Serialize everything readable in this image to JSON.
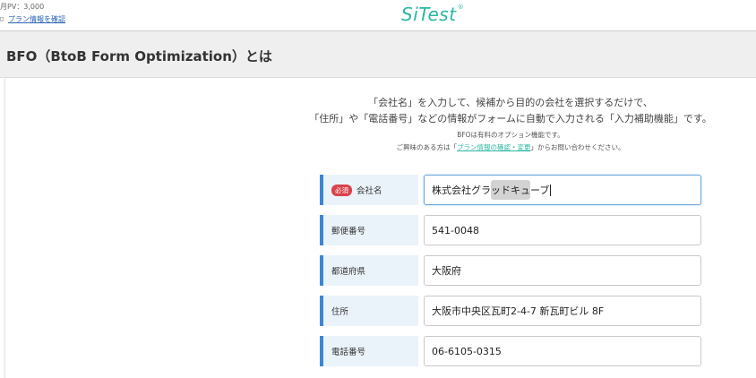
{
  "header": {
    "pv": "月PV：3,000",
    "plan_link": "プラン情報を確認",
    "logo": "SiTest",
    "logo_mark": "®"
  },
  "page": {
    "title": "BFO（BtoB Form Optimization）とは"
  },
  "intro": {
    "line1": "「会社名」を入力して、候補から目的の会社を選択するだけで、",
    "line2": "「住所」や「電話番号」などの情報がフォームに自動で入力される「入力補助機能」です。",
    "note1": "BFOは有料のオプション機能です。",
    "note2_pre": "ご興味のある方は「",
    "note2_link": "プラン情報の確認・変更",
    "note2_post": "」からお問い合わせください。"
  },
  "form": {
    "required_badge": "必須",
    "fields": [
      {
        "label": "会社名",
        "value_a": "株式会社グラ",
        "value_b": "ッドキュ",
        "value_c": "ーブ"
      },
      {
        "label": "郵便番号",
        "value": "541-0048"
      },
      {
        "label": "都道府県",
        "value": "大阪府"
      },
      {
        "label": "住所",
        "value": "大阪市中央区瓦町2-4-7 新瓦町ビル 8F"
      },
      {
        "label": "電話番号",
        "value": "06-6105-0315"
      }
    ]
  },
  "colors": {
    "brand": "#2bb7a3",
    "label_accent": "#3b86d6",
    "required": "#d9434b"
  }
}
